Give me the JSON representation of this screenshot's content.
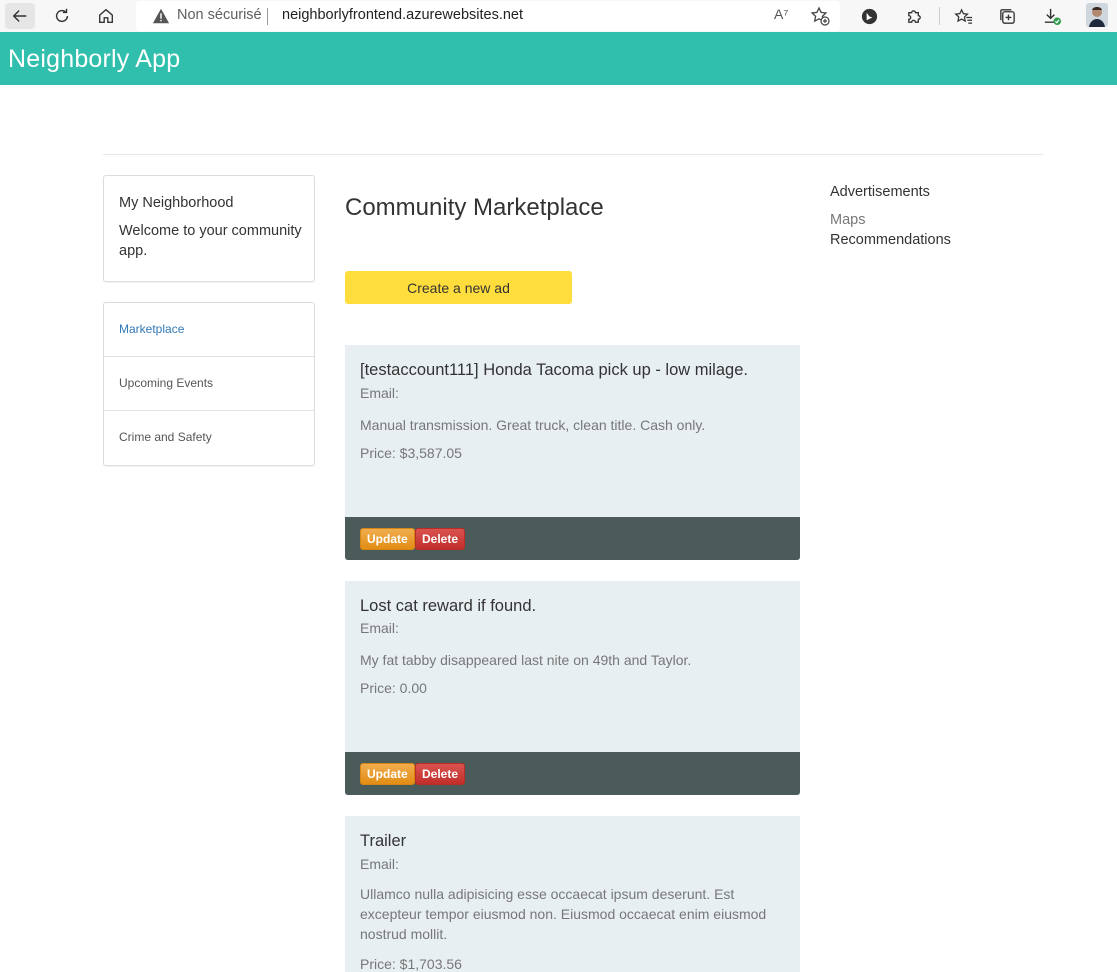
{
  "browser": {
    "not_secure_label": "Non sécurisé",
    "url": "neighborlyfrontend.azurewebsites.net",
    "read_aloud_glyph": "A⁷"
  },
  "header": {
    "brand": "Neighborly App"
  },
  "sidebar": {
    "welcome_title": "My Neighborhood",
    "welcome_text": "Welcome to your community app.",
    "items": [
      {
        "label": "Marketplace",
        "active": true
      },
      {
        "label": "Upcoming Events",
        "active": false
      },
      {
        "label": "Crime and Safety",
        "active": false
      }
    ]
  },
  "main": {
    "title": "Community Marketplace",
    "create_label": "Create a new ad",
    "ads": [
      {
        "title": "[testaccount111] Honda Tacoma pick up - low milage.",
        "email": "Email:",
        "description": "Manual transmission. Great truck, clean title. Cash only.",
        "price": "Price: $3,587.05"
      },
      {
        "title": "Lost cat reward if found.",
        "email": "Email:",
        "description": "My fat tabby disappeared last nite on 49th and Taylor.",
        "price": "Price: 0.00"
      },
      {
        "title": "Trailer",
        "email": "Email:",
        "description": "Ullamco nulla adipisicing esse occaecat ipsum deserunt. Est excepteur tempor eiusmod non. Eiusmod occaecat enim eiusmod nostrud mollit.",
        "price": "Price: $1,703.56"
      }
    ],
    "update_label": "Update",
    "delete_label": "Delete"
  },
  "right": {
    "advertisements": "Advertisements",
    "maps": "Maps",
    "recommendations": "Recommendations"
  },
  "colors": {
    "header": "#2fbfac",
    "create_button": "#ffdd3c",
    "card_bg": "#e8eff3",
    "card_footer": "#4b5b5a",
    "update": "#f0ad4e",
    "delete": "#d9534f"
  }
}
